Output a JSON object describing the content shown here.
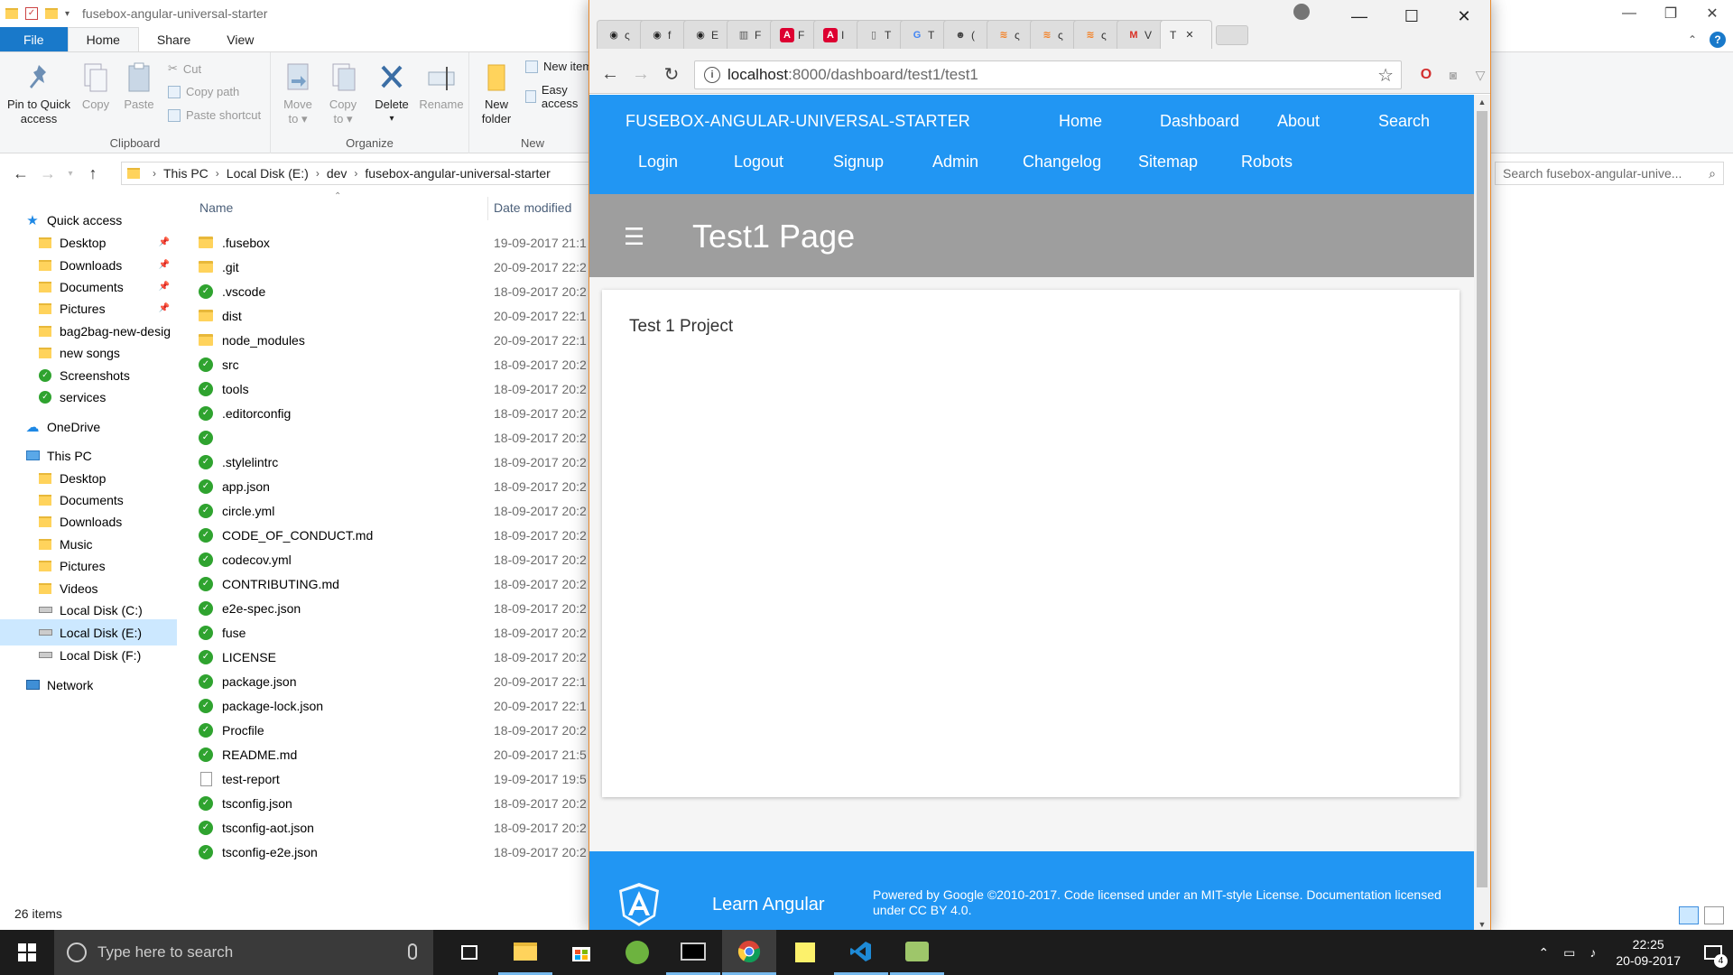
{
  "explorer": {
    "title_path": "fusebox-angular-universal-starter",
    "window_buttons": {
      "minimize": "—",
      "maximize": "❐",
      "close": "✕"
    },
    "tabs": [
      {
        "label": "File"
      },
      {
        "label": "Home"
      },
      {
        "label": "Share"
      },
      {
        "label": "View"
      }
    ],
    "ribbon": {
      "pin_label_1": "Pin to Quick",
      "pin_label_2": "access",
      "copy_label": "Copy",
      "paste_label": "Paste",
      "cut_label": "Cut",
      "copy_path_label": "Copy path",
      "paste_shortcut_label": "Paste shortcut",
      "clipboard_group": "Clipboard",
      "move_to_1": "Move",
      "move_to_2": "to ▾",
      "copy_to_1": "Copy",
      "copy_to_2": "to ▾",
      "delete_label": "Delete",
      "delete_arrow": "▾",
      "rename_label": "Rename",
      "organize_group": "Organize",
      "new_folder_1": "New",
      "new_folder_2": "folder",
      "new_item_label": "New item",
      "easy_access_label": "Easy access",
      "new_group": "New"
    },
    "breadcrumb": [
      "This PC",
      "Local Disk (E:)",
      "dev",
      "fusebox-angular-universal-starter"
    ],
    "search_placeholder": "Search fusebox-angular-unive...",
    "nav_items": [
      {
        "label": "Quick access",
        "icon": "star-icon",
        "pinned": false,
        "selected": false
      },
      {
        "label": "Desktop",
        "icon": "folder-icon",
        "pinned": true,
        "selected": false
      },
      {
        "label": "Downloads",
        "icon": "folder-icon",
        "pinned": true,
        "selected": false
      },
      {
        "label": "Documents",
        "icon": "folder-icon",
        "pinned": true,
        "selected": false
      },
      {
        "label": "Pictures",
        "icon": "folder-icon",
        "pinned": true,
        "selected": false
      },
      {
        "label": "bag2bag-new-desig",
        "icon": "folder-icon",
        "pinned": false,
        "selected": false
      },
      {
        "label": "new songs",
        "icon": "folder-icon",
        "pinned": false,
        "selected": false
      },
      {
        "label": "Screenshots",
        "icon": "synced-icon",
        "pinned": false,
        "selected": false
      },
      {
        "label": "services",
        "icon": "synced-icon",
        "pinned": false,
        "selected": false
      },
      {
        "label": "OneDrive",
        "icon": "cloud-icon",
        "pinned": false,
        "selected": false
      },
      {
        "label": "This PC",
        "icon": "pc-icon",
        "pinned": false,
        "selected": false
      },
      {
        "label": "Desktop",
        "icon": "folder-icon",
        "pinned": false,
        "selected": false
      },
      {
        "label": "Documents",
        "icon": "folder-icon",
        "pinned": false,
        "selected": false
      },
      {
        "label": "Downloads",
        "icon": "folder-icon",
        "pinned": false,
        "selected": false
      },
      {
        "label": "Music",
        "icon": "folder-icon",
        "pinned": false,
        "selected": false
      },
      {
        "label": "Pictures",
        "icon": "folder-icon",
        "pinned": false,
        "selected": false
      },
      {
        "label": "Videos",
        "icon": "folder-icon",
        "pinned": false,
        "selected": false
      },
      {
        "label": "Local Disk (C:)",
        "icon": "drive-icon",
        "pinned": false,
        "selected": false
      },
      {
        "label": "Local Disk (E:)",
        "icon": "drive-icon",
        "pinned": false,
        "selected": true
      },
      {
        "label": "Local Disk (F:)",
        "icon": "drive-icon",
        "pinned": false,
        "selected": false
      },
      {
        "label": "Network",
        "icon": "network-icon",
        "pinned": false,
        "selected": false
      }
    ],
    "columns": {
      "name": "Name",
      "date": "Date modified"
    },
    "files": [
      {
        "name": ".fusebox",
        "date": "19-09-2017 21:1",
        "type": "folder"
      },
      {
        "name": ".git",
        "date": "20-09-2017 22:2",
        "type": "folder"
      },
      {
        "name": ".vscode",
        "date": "18-09-2017 20:2",
        "type": "synced"
      },
      {
        "name": "dist",
        "date": "20-09-2017 22:1",
        "type": "folder"
      },
      {
        "name": "node_modules",
        "date": "20-09-2017 22:1",
        "type": "folder"
      },
      {
        "name": "src",
        "date": "18-09-2017 20:2",
        "type": "synced"
      },
      {
        "name": "tools",
        "date": "18-09-2017 20:2",
        "type": "synced"
      },
      {
        "name": ".editorconfig",
        "date": "18-09-2017 20:2",
        "type": "synced"
      },
      {
        "name": "",
        "date": "18-09-2017 20:2",
        "type": "synced"
      },
      {
        "name": ".stylelintrc",
        "date": "18-09-2017 20:2",
        "type": "synced"
      },
      {
        "name": "app.json",
        "date": "18-09-2017 20:2",
        "type": "synced"
      },
      {
        "name": "circle.yml",
        "date": "18-09-2017 20:2",
        "type": "synced"
      },
      {
        "name": "CODE_OF_CONDUCT.md",
        "date": "18-09-2017 20:2",
        "type": "synced"
      },
      {
        "name": "codecov.yml",
        "date": "18-09-2017 20:2",
        "type": "synced"
      },
      {
        "name": "CONTRIBUTING.md",
        "date": "18-09-2017 20:2",
        "type": "synced"
      },
      {
        "name": "e2e-spec.json",
        "date": "18-09-2017 20:2",
        "type": "synced"
      },
      {
        "name": "fuse",
        "date": "18-09-2017 20:2",
        "type": "synced"
      },
      {
        "name": "LICENSE",
        "date": "18-09-2017 20:2",
        "type": "synced"
      },
      {
        "name": "package.json",
        "date": "20-09-2017 22:1",
        "type": "synced"
      },
      {
        "name": "package-lock.json",
        "date": "20-09-2017 22:1",
        "type": "synced"
      },
      {
        "name": "Procfile",
        "date": "18-09-2017 20:2",
        "type": "synced"
      },
      {
        "name": "README.md",
        "date": "20-09-2017 21:5",
        "type": "synced"
      },
      {
        "name": "test-report",
        "date": "19-09-2017 19:5",
        "type": "file"
      },
      {
        "name": "tsconfig.json",
        "date": "18-09-2017 20:2",
        "type": "synced"
      },
      {
        "name": "tsconfig-aot.json",
        "date": "18-09-2017 20:2",
        "type": "synced"
      },
      {
        "name": "tsconfig-e2e.json",
        "date": "18-09-2017 20:2",
        "type": "synced"
      }
    ],
    "status_text": "26 items"
  },
  "chrome": {
    "tabs": [
      {
        "icon": "github-icon",
        "glyph": "◉",
        "letter": "ς"
      },
      {
        "icon": "github-icon",
        "glyph": "◉",
        "letter": "f"
      },
      {
        "icon": "github-icon",
        "glyph": "◉",
        "letter": "E"
      },
      {
        "icon": "chart-tab-icon",
        "glyph": "▥",
        "letter": "F"
      },
      {
        "icon": "angular-icon",
        "glyph": "A",
        "letter": "F"
      },
      {
        "icon": "angular-icon",
        "glyph": "A",
        "letter": "I"
      },
      {
        "icon": "doc-tab-icon",
        "glyph": "▯",
        "letter": "T"
      },
      {
        "icon": "google-icon",
        "glyph": "G",
        "letter": "T"
      },
      {
        "icon": "incognito-icon",
        "glyph": "☻",
        "letter": "("
      },
      {
        "icon": "stackoverflow-icon",
        "glyph": "≋",
        "letter": "ς"
      },
      {
        "icon": "stackoverflow-icon",
        "glyph": "≋",
        "letter": "ς"
      },
      {
        "icon": "stackoverflow-icon",
        "glyph": "≋",
        "letter": "ς"
      },
      {
        "icon": "gmail-icon",
        "glyph": "M",
        "letter": "V"
      },
      {
        "icon": "",
        "glyph": "",
        "letter": "T",
        "active": true,
        "close": "✕"
      }
    ],
    "window_buttons": {
      "minimize": "—",
      "maximize": "☐",
      "close": "✕"
    },
    "back": "←",
    "forward": "→",
    "reload": "↻",
    "url_host": "localhost",
    "url_rest": ":8000/dashboard/test1/test1",
    "info_glyph": "i",
    "star": "☆",
    "menu_glyph": "⋮",
    "page": {
      "brand": "FUSEBOX-ANGULAR-UNIVERSAL-STARTER",
      "nav_row1": [
        "Home",
        "Dashboard",
        "About",
        "Search"
      ],
      "nav_row2": [
        "Login",
        "Logout",
        "Signup",
        "Admin",
        "Changelog",
        "Sitemap",
        "Robots"
      ],
      "menu_glyph": "☰",
      "toolbar_title": "Test1 Page",
      "card_text": "Test 1 Project",
      "footer_learn": "Learn Angular",
      "footer_powered": "Powered by Google ©2010-2017. Code licensed under an MIT-style License. Documentation licensed under CC BY 4.0."
    }
  },
  "taskbar": {
    "search_placeholder": "Type here to search",
    "time": "22:25",
    "date": "20-09-2017",
    "notification_count": "4"
  },
  "colors": {
    "primary": "#2196f3",
    "toolbar_grey": "#9e9e9e",
    "explorer_accent": "#1979ca",
    "selection": "#cce8ff"
  }
}
